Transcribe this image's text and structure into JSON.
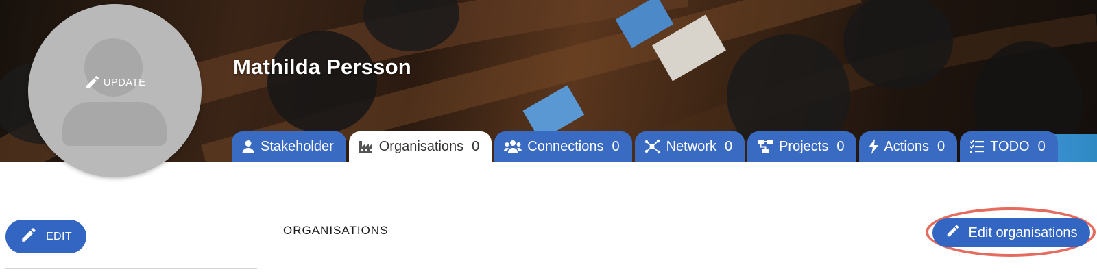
{
  "profile": {
    "name": "Mathilda Persson",
    "avatar_update_label": "UPDATE"
  },
  "tabs": [
    {
      "label": "Stakeholder",
      "count": "",
      "icon": "person-icon",
      "active": false
    },
    {
      "label": "Organisations",
      "count": "0",
      "icon": "factory-icon",
      "active": true
    },
    {
      "label": "Connections",
      "count": "0",
      "icon": "users-icon",
      "active": false
    },
    {
      "label": "Network",
      "count": "0",
      "icon": "network-icon",
      "active": false
    },
    {
      "label": "Projects",
      "count": "0",
      "icon": "sitemap-icon",
      "active": false
    },
    {
      "label": "Actions",
      "count": "0",
      "icon": "bolt-icon",
      "active": false
    },
    {
      "label": "TODO",
      "count": "0",
      "icon": "checklist-icon",
      "active": false
    }
  ],
  "sidebar": {
    "edit_label": "EDIT"
  },
  "main": {
    "section_title": "ORGANISATIONS",
    "edit_organisations_label": "Edit organisations"
  },
  "colors": {
    "primary": "#3366c2",
    "tab_blue": "#3a6bc3",
    "highlight": "#e46b5e",
    "avatar_gray": "#b9b9b9"
  }
}
